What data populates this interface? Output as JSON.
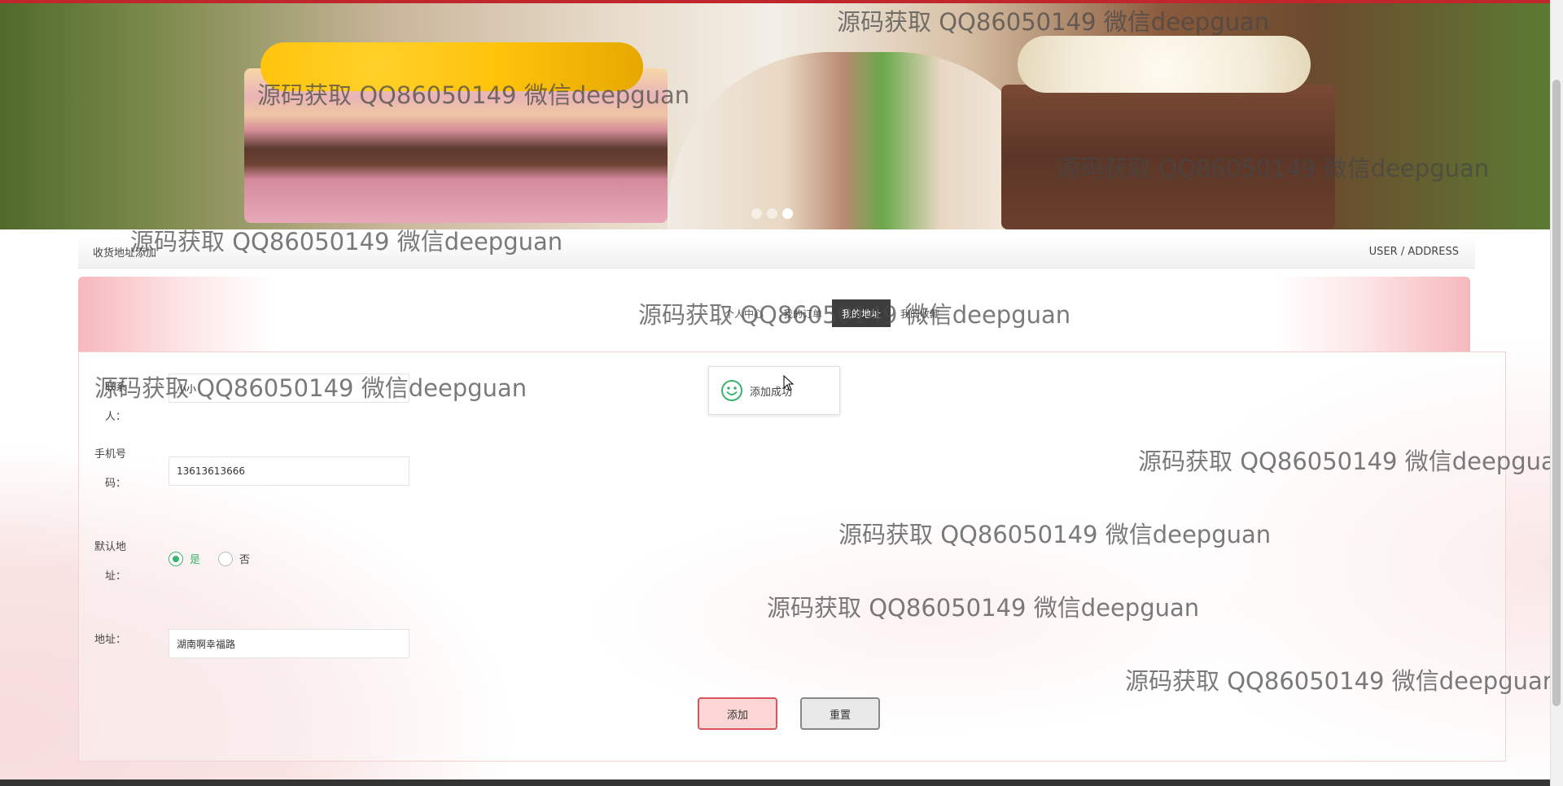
{
  "banner": {
    "slide_count": 3,
    "active_slide": 3
  },
  "title_bar": {
    "title": "收货地址添加",
    "breadcrumb": "USER / ADDRESS"
  },
  "tabs": [
    {
      "label": "个人中心",
      "active": false
    },
    {
      "label": "我的订单",
      "active": false
    },
    {
      "label": "我的地址",
      "active": true
    },
    {
      "label": "我的收藏",
      "active": false
    }
  ],
  "form": {
    "consignee": {
      "label": "联系人：",
      "value": "小小"
    },
    "phone": {
      "label": "手机号码：",
      "value": "13613613666"
    },
    "is_default": {
      "label": "默认地址：",
      "options": [
        "是",
        "否"
      ],
      "selected": "是"
    },
    "address": {
      "label": "地址：",
      "value": "湖南啊幸福路"
    },
    "add_label": "添加",
    "reset_label": "重置"
  },
  "toast": {
    "message": "添加成功"
  },
  "watermark": "源码获取 QQ86050149 微信deepguan",
  "colors": {
    "accent_red": "#c0272d",
    "success_green": "#3cb371",
    "pink": "#f6b8bd"
  }
}
